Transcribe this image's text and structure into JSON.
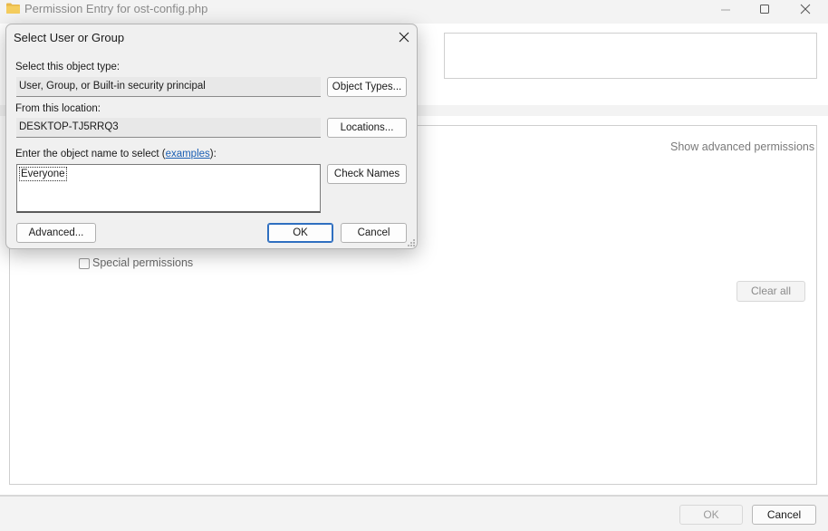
{
  "background_window": {
    "title": "Permission Entry for ost-config.php",
    "show_advanced_label": "Show advanced permissions",
    "special_permissions_label": "Special permissions",
    "clear_all_label": "Clear all",
    "ok_label": "OK",
    "cancel_label": "Cancel",
    "icons": {
      "folder": "folder-icon",
      "minimize": "minimize-icon",
      "maximize": "maximize-icon",
      "close": "close-icon"
    }
  },
  "dialog": {
    "title": "Select User or Group",
    "object_type_label": "Select this object type:",
    "object_type_value": "User, Group, or Built-in security principal",
    "object_types_button": "Object Types...",
    "location_label": "From this location:",
    "location_value": "DESKTOP-TJ5RRQ3",
    "locations_button": "Locations...",
    "name_label_prefix": "Enter the object name to select (",
    "name_label_link": "examples",
    "name_label_suffix": "):",
    "name_value": "Everyone",
    "check_names_button": "Check Names",
    "advanced_button": "Advanced...",
    "ok_button": "OK",
    "cancel_button": "Cancel"
  },
  "colors": {
    "accent": "#2f6fc0",
    "link": "#1a5fb4",
    "folder": "#e8b84a"
  }
}
